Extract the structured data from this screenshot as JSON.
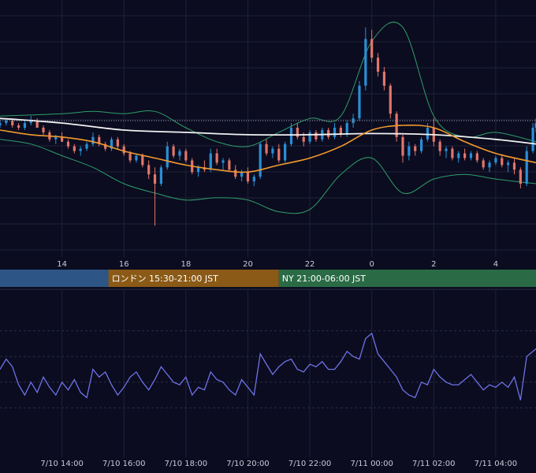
{
  "colors": {
    "background": "#0b0c20",
    "grid": "#1f2238",
    "candle_up": "#2a8fd6",
    "candle_down": "#e2766a",
    "ma_short": "#f29a2e",
    "ma_long": "#f2f2f2",
    "bollinger": "#2e9e6a",
    "oscillator": "#6f72e6",
    "session_tokyo": "#2d5585",
    "session_london": "#8a5a16",
    "session_ny": "#2a6b46"
  },
  "sessions": [
    {
      "label": "",
      "start": 12.0,
      "end": 15.5,
      "color": "#2d5585"
    },
    {
      "label": "ロンドン 15:30-21:00 JST",
      "start": 15.5,
      "end": 21.0,
      "color": "#8a5a16"
    },
    {
      "label": "NY 21:00-06:00 JST",
      "start": 21.0,
      "end": 30.0,
      "color": "#2a6b46"
    }
  ],
  "chart_data": [
    {
      "type": "candlestick",
      "x_axis": {
        "unit": "hour",
        "range": [
          12.0,
          29.3
        ],
        "tick_values": [
          14,
          16,
          18,
          20,
          22,
          24,
          26,
          28
        ],
        "tick_labels": [
          "14",
          "16",
          "18",
          "20",
          "22",
          "0",
          "2",
          "4"
        ]
      },
      "y_axis": {
        "range": [
          0,
          100
        ],
        "labels_visible": false
      },
      "reference_line": {
        "value": 53,
        "style": "dotted"
      },
      "ma_long": [
        [
          12.0,
          54
        ],
        [
          14,
          52
        ],
        [
          16,
          49
        ],
        [
          18,
          48
        ],
        [
          20,
          47
        ],
        [
          22,
          47
        ],
        [
          24,
          47.5
        ],
        [
          26,
          47
        ],
        [
          28,
          45
        ],
        [
          29.3,
          43
        ]
      ],
      "ma_short": [
        [
          12.0,
          49
        ],
        [
          13,
          47
        ],
        [
          14,
          46
        ],
        [
          15,
          44
        ],
        [
          16,
          40
        ],
        [
          17,
          37
        ],
        [
          18,
          34
        ],
        [
          19,
          32
        ],
        [
          20,
          31
        ],
        [
          21,
          34
        ],
        [
          22,
          37
        ],
        [
          23,
          42
        ],
        [
          24,
          49
        ],
        [
          25,
          51
        ],
        [
          26,
          50
        ],
        [
          27,
          44
        ],
        [
          28,
          39
        ],
        [
          29.3,
          35
        ]
      ],
      "bollinger_upper": [
        [
          12.0,
          55
        ],
        [
          14,
          56
        ],
        [
          15,
          57
        ],
        [
          16,
          56
        ],
        [
          17,
          57
        ],
        [
          18,
          50
        ],
        [
          19,
          44
        ],
        [
          20,
          42
        ],
        [
          21,
          48
        ],
        [
          22,
          54
        ],
        [
          23,
          55
        ],
        [
          24,
          87
        ],
        [
          25,
          93
        ],
        [
          26,
          55
        ],
        [
          27,
          46
        ],
        [
          28,
          48
        ],
        [
          29.3,
          44
        ]
      ],
      "bollinger_lower": [
        [
          12.0,
          45
        ],
        [
          13,
          43
        ],
        [
          14,
          38
        ],
        [
          15,
          33
        ],
        [
          16,
          26
        ],
        [
          17,
          22
        ],
        [
          18,
          19
        ],
        [
          19,
          20
        ],
        [
          20,
          19
        ],
        [
          21,
          14
        ],
        [
          22,
          15
        ],
        [
          23,
          30
        ],
        [
          24,
          37
        ],
        [
          25,
          22
        ],
        [
          26,
          28
        ],
        [
          27,
          30
        ],
        [
          28,
          28
        ],
        [
          29.3,
          26
        ]
      ],
      "candles": [
        [
          12.0,
          51,
          53,
          50,
          52
        ],
        [
          12.2,
          52,
          54,
          51,
          53
        ],
        [
          12.4,
          53,
          54,
          50,
          51
        ],
        [
          12.6,
          51,
          52,
          49,
          50
        ],
        [
          12.8,
          50,
          53,
          49,
          52
        ],
        [
          13.0,
          52,
          55,
          51,
          53
        ],
        [
          13.2,
          53,
          54,
          50,
          50
        ],
        [
          13.4,
          50,
          51,
          47,
          48
        ],
        [
          13.6,
          48,
          49,
          44,
          45
        ],
        [
          13.8,
          45,
          47,
          43,
          46
        ],
        [
          14.0,
          46,
          48,
          44,
          44
        ],
        [
          14.2,
          44,
          45,
          41,
          42
        ],
        [
          14.4,
          42,
          43,
          39,
          40
        ],
        [
          14.6,
          40,
          42,
          38,
          41
        ],
        [
          14.8,
          41,
          44,
          40,
          43
        ],
        [
          15.0,
          43,
          48,
          42,
          46
        ],
        [
          15.2,
          46,
          47,
          42,
          43
        ],
        [
          15.4,
          43,
          44,
          40,
          41
        ],
        [
          15.6,
          41,
          46,
          40,
          45
        ],
        [
          15.8,
          45,
          46,
          41,
          42
        ],
        [
          16.0,
          42,
          43,
          38,
          39
        ],
        [
          16.2,
          39,
          40,
          35,
          36
        ],
        [
          16.4,
          36,
          39,
          35,
          38
        ],
        [
          16.6,
          38,
          39,
          33,
          34
        ],
        [
          16.8,
          34,
          36,
          28,
          30
        ],
        [
          17.0,
          30,
          33,
          8,
          26
        ],
        [
          17.2,
          26,
          34,
          25,
          33
        ],
        [
          17.4,
          33,
          44,
          32,
          42
        ],
        [
          17.6,
          42,
          43,
          37,
          38
        ],
        [
          17.8,
          38,
          41,
          36,
          40
        ],
        [
          18.0,
          40,
          41,
          35,
          36
        ],
        [
          18.2,
          36,
          37,
          30,
          31
        ],
        [
          18.4,
          31,
          34,
          29,
          33
        ],
        [
          18.6,
          33,
          36,
          31,
          32
        ],
        [
          18.8,
          32,
          41,
          31,
          39
        ],
        [
          19.0,
          39,
          41,
          34,
          35
        ],
        [
          19.2,
          35,
          37,
          32,
          36
        ],
        [
          19.4,
          36,
          37,
          31,
          32
        ],
        [
          19.6,
          32,
          34,
          28,
          29
        ],
        [
          19.8,
          29,
          32,
          27,
          31
        ],
        [
          20.0,
          31,
          33,
          26,
          27
        ],
        [
          20.2,
          27,
          30,
          25,
          29
        ],
        [
          20.4,
          29,
          44,
          28,
          43
        ],
        [
          20.6,
          43,
          45,
          38,
          39
        ],
        [
          20.8,
          39,
          42,
          37,
          41
        ],
        [
          21.0,
          41,
          43,
          35,
          36
        ],
        [
          21.2,
          36,
          44,
          35,
          43
        ],
        [
          21.4,
          43,
          52,
          42,
          50
        ],
        [
          21.6,
          50,
          52,
          45,
          46
        ],
        [
          21.8,
          46,
          48,
          42,
          44
        ],
        [
          22.0,
          44,
          49,
          43,
          48
        ],
        [
          22.2,
          48,
          49,
          44,
          45
        ],
        [
          22.4,
          45,
          50,
          44,
          49
        ],
        [
          22.6,
          49,
          50,
          45,
          46
        ],
        [
          22.8,
          46,
          52,
          45,
          50
        ],
        [
          23.0,
          50,
          51,
          46,
          47
        ],
        [
          23.2,
          47,
          53,
          46,
          52
        ],
        [
          23.4,
          52,
          56,
          50,
          54
        ],
        [
          23.6,
          54,
          70,
          53,
          68
        ],
        [
          23.8,
          68,
          93,
          66,
          88
        ],
        [
          24.0,
          88,
          92,
          78,
          80
        ],
        [
          24.2,
          80,
          82,
          72,
          74
        ],
        [
          24.4,
          74,
          76,
          66,
          68
        ],
        [
          24.6,
          68,
          69,
          54,
          56
        ],
        [
          24.8,
          56,
          57,
          44,
          46
        ],
        [
          25.0,
          46,
          47,
          35,
          38
        ],
        [
          25.2,
          38,
          44,
          36,
          42
        ],
        [
          25.4,
          42,
          43,
          38,
          40
        ],
        [
          25.6,
          40,
          46,
          39,
          45
        ],
        [
          25.8,
          45,
          52,
          44,
          50
        ],
        [
          26.0,
          50,
          54,
          42,
          44
        ],
        [
          26.2,
          44,
          45,
          38,
          40
        ],
        [
          26.4,
          40,
          42,
          37,
          41
        ],
        [
          26.6,
          41,
          42,
          36,
          37
        ],
        [
          26.8,
          37,
          40,
          35,
          39
        ],
        [
          27.0,
          39,
          41,
          36,
          37
        ],
        [
          27.2,
          37,
          40,
          36,
          39
        ],
        [
          27.4,
          39,
          40,
          35,
          36
        ],
        [
          27.6,
          36,
          37,
          32,
          33
        ],
        [
          27.8,
          33,
          36,
          31,
          35
        ],
        [
          28.0,
          35,
          38,
          34,
          37
        ],
        [
          28.2,
          37,
          38,
          33,
          34
        ],
        [
          28.4,
          34,
          36,
          31,
          35
        ],
        [
          28.6,
          35,
          37,
          30,
          32
        ],
        [
          28.8,
          32,
          33,
          24,
          26
        ],
        [
          29.0,
          26,
          42,
          25,
          40
        ],
        [
          29.2,
          40,
          52,
          39,
          50
        ],
        [
          29.3,
          50,
          54,
          48,
          52
        ]
      ]
    },
    {
      "type": "line",
      "x_axis": {
        "unit": "hour",
        "range": [
          12.0,
          29.3
        ],
        "tick_values": [
          14,
          16,
          18,
          20,
          22,
          24,
          26,
          28
        ],
        "tick_labels": [
          "7/10 14:00",
          "7/10 16:00",
          "7/10 18:00",
          "7/10 20:00",
          "7/10 22:00",
          "7/11 00:00",
          "7/11 02:00",
          "7/11 04:00"
        ]
      },
      "y_axis": {
        "range": [
          0,
          100
        ],
        "labels_visible": false
      },
      "x": [
        12.0,
        12.2,
        12.4,
        12.6,
        12.8,
        13.0,
        13.2,
        13.4,
        13.6,
        13.8,
        14.0,
        14.2,
        14.4,
        14.6,
        14.8,
        15.0,
        15.2,
        15.4,
        15.6,
        15.8,
        16.0,
        16.2,
        16.4,
        16.6,
        16.8,
        17.0,
        17.2,
        17.4,
        17.6,
        17.8,
        18.0,
        18.2,
        18.4,
        18.6,
        18.8,
        19.0,
        19.2,
        19.4,
        19.6,
        19.8,
        20.0,
        20.2,
        20.4,
        20.6,
        20.8,
        21.0,
        21.2,
        21.4,
        21.6,
        21.8,
        22.0,
        22.2,
        22.4,
        22.6,
        22.8,
        23.0,
        23.2,
        23.4,
        23.6,
        23.8,
        24.0,
        24.2,
        24.4,
        24.6,
        24.8,
        25.0,
        25.2,
        25.4,
        25.6,
        25.8,
        26.0,
        26.2,
        26.4,
        26.6,
        26.8,
        27.0,
        27.2,
        27.4,
        27.6,
        27.8,
        28.0,
        28.2,
        28.4,
        28.6,
        28.8,
        29.0,
        29.2,
        29.3
      ],
      "values": [
        50,
        58,
        52,
        38,
        30,
        40,
        32,
        44,
        36,
        30,
        40,
        34,
        42,
        32,
        28,
        50,
        44,
        48,
        38,
        30,
        36,
        44,
        48,
        40,
        34,
        42,
        52,
        46,
        40,
        38,
        44,
        30,
        36,
        34,
        48,
        42,
        40,
        34,
        30,
        42,
        36,
        30,
        62,
        54,
        46,
        52,
        56,
        58,
        50,
        48,
        54,
        52,
        56,
        50,
        50,
        56,
        64,
        60,
        58,
        74,
        78,
        62,
        56,
        50,
        44,
        34,
        30,
        28,
        40,
        38,
        50,
        44,
        40,
        38,
        38,
        42,
        46,
        40,
        34,
        38,
        36,
        40,
        36,
        44,
        26,
        60,
        64,
        66
      ]
    }
  ]
}
